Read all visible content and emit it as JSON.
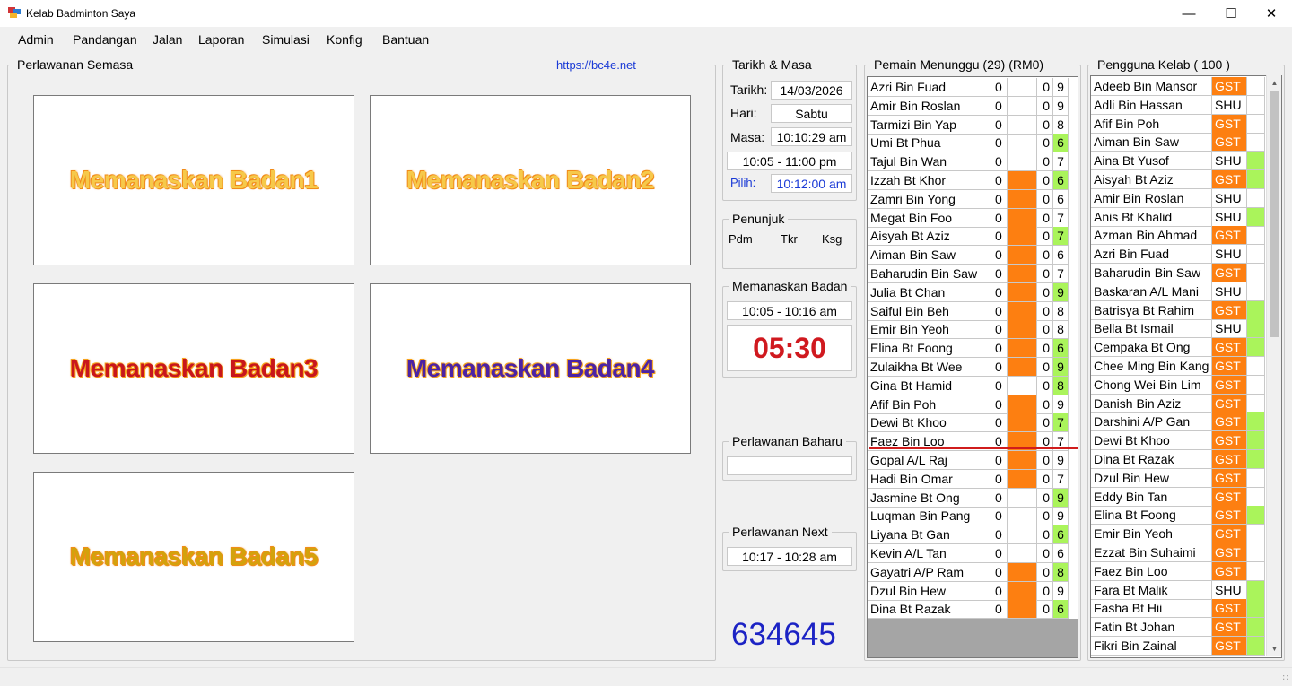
{
  "window": {
    "title": "Kelab Badminton Saya"
  },
  "menu": [
    "Admin",
    "Pandangan",
    "Jalan",
    "Laporan",
    "Simulasi",
    "Konfig",
    "Bantuan"
  ],
  "current_matches": {
    "title": "Perlawanan Semasa",
    "link": "https://bc4e.net",
    "courts": [
      {
        "label": "Memanaskan Badan1",
        "style": "yellow"
      },
      {
        "label": "Memanaskan Badan2",
        "style": "yellow"
      },
      {
        "label": "Memanaskan Badan3",
        "style": "red"
      },
      {
        "label": "Memanaskan Badan4",
        "style": "purple"
      },
      {
        "label": "Memanaskan Badan5",
        "style": "gold"
      }
    ]
  },
  "datetime": {
    "title": "Tarikh & Masa",
    "date_label": "Tarikh:",
    "date": "14/03/2026",
    "day_label": "Hari:",
    "day": "Sabtu",
    "time_label": "Masa:",
    "time": "10:10:29 am",
    "range": "10:05 - 11:00 pm",
    "pick_label": "Pilih:",
    "pick": "10:12:00 am"
  },
  "indicator": {
    "title": "Penunjuk",
    "items": [
      "Pdm",
      "Tkr",
      "Ksg"
    ]
  },
  "warmup": {
    "title": "Memanaskan Badan",
    "range": "10:05 - 10:16 am",
    "countdown": "05:30"
  },
  "new_match": {
    "title": "Perlawanan Baharu",
    "value": ""
  },
  "next_match": {
    "title": "Perlawanan Next",
    "range": "10:17 - 10:28 am"
  },
  "big_number": "634645",
  "waiting": {
    "title": "Pemain Menunggu (29) (RM0)",
    "rows": [
      {
        "name": "Azri Bin Fuad",
        "a": "0",
        "orange": false,
        "b": "0",
        "n": "9",
        "green": false
      },
      {
        "name": "Amir Bin Roslan",
        "a": "0",
        "orange": false,
        "b": "0",
        "n": "9",
        "green": false
      },
      {
        "name": "Tarmizi Bin Yap",
        "a": "0",
        "orange": false,
        "b": "0",
        "n": "8",
        "green": false
      },
      {
        "name": "Umi Bt Phua",
        "a": "0",
        "orange": false,
        "b": "0",
        "n": "6",
        "green": true
      },
      {
        "name": "Tajul Bin Wan",
        "a": "0",
        "orange": false,
        "b": "0",
        "n": "7",
        "green": false
      },
      {
        "name": "Izzah Bt Khor",
        "a": "0",
        "orange": true,
        "b": "0",
        "n": "6",
        "green": true
      },
      {
        "name": "Zamri Bin Yong",
        "a": "0",
        "orange": true,
        "b": "0",
        "n": "6",
        "green": false
      },
      {
        "name": "Megat Bin Foo",
        "a": "0",
        "orange": true,
        "b": "0",
        "n": "7",
        "green": false
      },
      {
        "name": "Aisyah Bt Aziz",
        "a": "0",
        "orange": true,
        "b": "0",
        "n": "7",
        "green": true
      },
      {
        "name": "Aiman Bin Saw",
        "a": "0",
        "orange": true,
        "b": "0",
        "n": "6",
        "green": false
      },
      {
        "name": "Baharudin Bin Saw",
        "a": "0",
        "orange": true,
        "b": "0",
        "n": "7",
        "green": false
      },
      {
        "name": "Julia Bt Chan",
        "a": "0",
        "orange": true,
        "b": "0",
        "n": "9",
        "green": true
      },
      {
        "name": "Saiful Bin Beh",
        "a": "0",
        "orange": true,
        "b": "0",
        "n": "8",
        "green": false
      },
      {
        "name": "Emir Bin Yeoh",
        "a": "0",
        "orange": true,
        "b": "0",
        "n": "8",
        "green": false
      },
      {
        "name": "Elina Bt Foong",
        "a": "0",
        "orange": true,
        "b": "0",
        "n": "6",
        "green": true
      },
      {
        "name": "Zulaikha Bt Wee",
        "a": "0",
        "orange": true,
        "b": "0",
        "n": "9",
        "green": true
      },
      {
        "name": "Gina Bt Hamid",
        "a": "0",
        "orange": false,
        "b": "0",
        "n": "8",
        "green": true
      },
      {
        "name": "Afif Bin Poh",
        "a": "0",
        "orange": true,
        "b": "0",
        "n": "9",
        "green": false
      },
      {
        "name": "Dewi Bt Khoo",
        "a": "0",
        "orange": true,
        "b": "0",
        "n": "7",
        "green": true
      },
      {
        "name": "Faez Bin Loo",
        "a": "0",
        "orange": true,
        "b": "0",
        "n": "7",
        "green": false
      },
      {
        "name": "Gopal A/L Raj",
        "a": "0",
        "orange": true,
        "b": "0",
        "n": "9",
        "green": false
      },
      {
        "name": "Hadi Bin Omar",
        "a": "0",
        "orange": true,
        "b": "0",
        "n": "7",
        "green": false
      },
      {
        "name": "Jasmine Bt Ong",
        "a": "0",
        "orange": false,
        "b": "0",
        "n": "9",
        "green": true
      },
      {
        "name": "Luqman Bin Pang",
        "a": "0",
        "orange": false,
        "b": "0",
        "n": "9",
        "green": false
      },
      {
        "name": "Liyana Bt Gan",
        "a": "0",
        "orange": false,
        "b": "0",
        "n": "6",
        "green": true
      },
      {
        "name": "Kevin A/L Tan",
        "a": "0",
        "orange": false,
        "b": "0",
        "n": "6",
        "green": false
      },
      {
        "name": "Gayatri A/P Ram",
        "a": "0",
        "orange": true,
        "b": "0",
        "n": "8",
        "green": true
      },
      {
        "name": "Dzul Bin Hew",
        "a": "0",
        "orange": true,
        "b": "0",
        "n": "9",
        "green": false
      },
      {
        "name": "Dina Bt Razak",
        "a": "0",
        "orange": true,
        "b": "0",
        "n": "6",
        "green": true
      }
    ]
  },
  "members": {
    "title": "Pengguna Kelab ( 100 )",
    "rows": [
      {
        "name": "Adeeb Bin Mansor",
        "type": "GST",
        "flag": false
      },
      {
        "name": "Adli Bin Hassan",
        "type": "SHU",
        "flag": false
      },
      {
        "name": "Afif Bin Poh",
        "type": "GST",
        "flag": false
      },
      {
        "name": "Aiman Bin Saw",
        "type": "GST",
        "flag": false
      },
      {
        "name": "Aina Bt Yusof",
        "type": "SHU",
        "flag": true
      },
      {
        "name": "Aisyah Bt Aziz",
        "type": "GST",
        "flag": true
      },
      {
        "name": "Amir Bin Roslan",
        "type": "SHU",
        "flag": false
      },
      {
        "name": "Anis Bt Khalid",
        "type": "SHU",
        "flag": true
      },
      {
        "name": "Azman Bin Ahmad",
        "type": "GST",
        "flag": false
      },
      {
        "name": "Azri Bin Fuad",
        "type": "SHU",
        "flag": false
      },
      {
        "name": "Baharudin Bin Saw",
        "type": "GST",
        "flag": false
      },
      {
        "name": "Baskaran A/L Mani",
        "type": "SHU",
        "flag": false
      },
      {
        "name": "Batrisya Bt Rahim",
        "type": "GST",
        "flag": true
      },
      {
        "name": "Bella Bt Ismail",
        "type": "SHU",
        "flag": true
      },
      {
        "name": "Cempaka Bt Ong",
        "type": "GST",
        "flag": true
      },
      {
        "name": "Chee Ming Bin Kang",
        "type": "GST",
        "flag": false
      },
      {
        "name": "Chong Wei Bin Lim",
        "type": "GST",
        "flag": false
      },
      {
        "name": "Danish Bin Aziz",
        "type": "GST",
        "flag": false
      },
      {
        "name": "Darshini A/P Gan",
        "type": "GST",
        "flag": true
      },
      {
        "name": "Dewi Bt Khoo",
        "type": "GST",
        "flag": true
      },
      {
        "name": "Dina Bt Razak",
        "type": "GST",
        "flag": true
      },
      {
        "name": "Dzul Bin Hew",
        "type": "GST",
        "flag": false
      },
      {
        "name": "Eddy Bin Tan",
        "type": "GST",
        "flag": false
      },
      {
        "name": "Elina Bt Foong",
        "type": "GST",
        "flag": true
      },
      {
        "name": "Emir Bin Yeoh",
        "type": "GST",
        "flag": false
      },
      {
        "name": "Ezzat Bin Suhaimi",
        "type": "GST",
        "flag": false
      },
      {
        "name": "Faez Bin Loo",
        "type": "GST",
        "flag": false
      },
      {
        "name": "Fara Bt Malik",
        "type": "SHU",
        "flag": true
      },
      {
        "name": "Fasha Bt Hii",
        "type": "GST",
        "flag": true
      },
      {
        "name": "Fatin Bt Johan",
        "type": "GST",
        "flag": true
      },
      {
        "name": "Fikri Bin Zainal",
        "type": "GST",
        "flag": true
      }
    ]
  },
  "colors": {
    "orange": "#fd7f11",
    "green": "#aaf45b",
    "grey": "#a5a5a5"
  }
}
